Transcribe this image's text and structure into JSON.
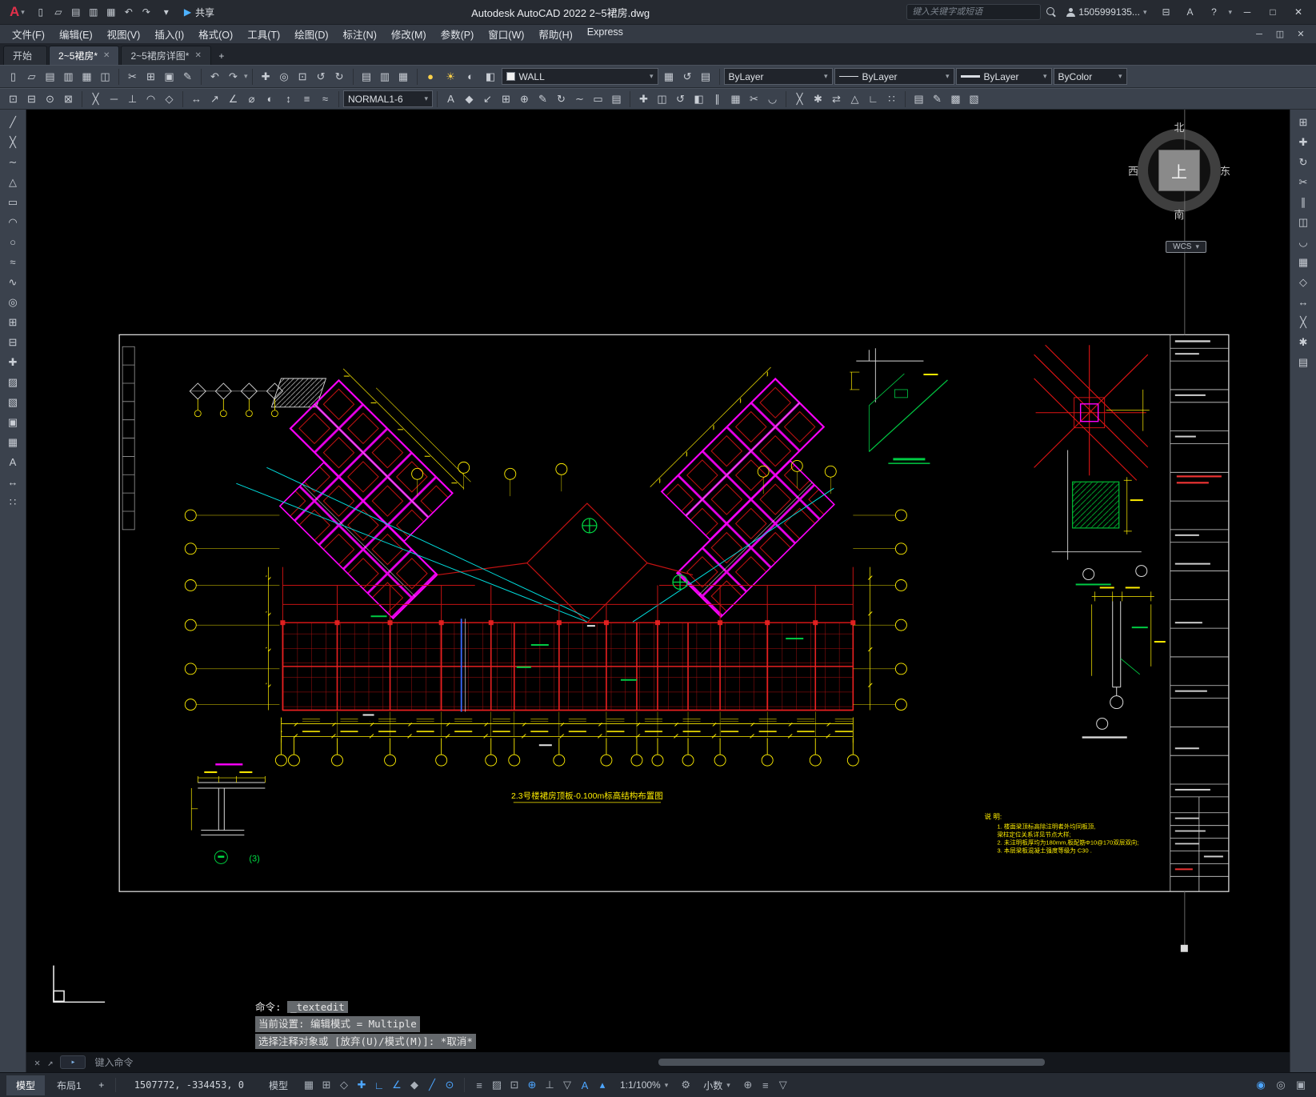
{
  "window": {
    "app_button": "A",
    "app_caret": "▾",
    "title": "Autodesk AutoCAD 2022   2~5裙房.dwg",
    "share": "共享",
    "share_icon": "▶",
    "search_placeholder": "键入关键字或短语",
    "account": "1505999135...",
    "store_icon": "⊟",
    "app_store_icon": "A",
    "help_icon": "?",
    "quick_access": [
      {
        "name": "qnew-icon",
        "glyph": "▯"
      },
      {
        "name": "open-icon",
        "glyph": "▱"
      },
      {
        "name": "save-icon",
        "glyph": "▤"
      },
      {
        "name": "saveas-icon",
        "glyph": "▥"
      },
      {
        "name": "plot-icon",
        "glyph": "▦"
      },
      {
        "name": "undo-icon",
        "glyph": "↶"
      },
      {
        "name": "redo-icon",
        "glyph": "↷"
      }
    ],
    "window_buttons": [
      {
        "name": "minimize-button",
        "glyph": "─"
      },
      {
        "name": "maximize-button",
        "glyph": "□"
      },
      {
        "name": "close-button",
        "glyph": "✕"
      }
    ]
  },
  "menubar": {
    "items": [
      "文件(F)",
      "编辑(E)",
      "视图(V)",
      "插入(I)",
      "格式(O)",
      "工具(T)",
      "绘图(D)",
      "标注(N)",
      "修改(M)",
      "参数(P)",
      "窗口(W)",
      "帮助(H)",
      "Express"
    ],
    "doc_buttons": [
      {
        "name": "doc-minimize-button",
        "glyph": "─"
      },
      {
        "name": "doc-restore-button",
        "glyph": "◫"
      },
      {
        "name": "doc-close-button",
        "glyph": "✕"
      }
    ]
  },
  "tabs": {
    "items": [
      {
        "name": "start",
        "label": "开始",
        "active": false,
        "close": ""
      },
      {
        "name": "drawing-1",
        "label": "2~5裙房*",
        "active": true,
        "close": "✕"
      },
      {
        "name": "drawing-2",
        "label": "2~5裙房详图*",
        "active": false,
        "close": "✕"
      }
    ],
    "new_tab": "+"
  },
  "toolbar1": {
    "g_file": [
      {
        "name": "new-icon",
        "glyph": "▯"
      },
      {
        "name": "open-icon",
        "glyph": "▱"
      },
      {
        "name": "save-icon",
        "glyph": "▤"
      },
      {
        "name": "saveas-icon",
        "glyph": "▥"
      },
      {
        "name": "plot-icon",
        "glyph": "▦"
      },
      {
        "name": "plot-preview-icon",
        "glyph": "◫"
      }
    ],
    "g_clip": [
      {
        "name": "cut-icon",
        "glyph": "✂"
      },
      {
        "name": "copy-icon",
        "glyph": "⊞"
      },
      {
        "name": "paste-icon",
        "glyph": "▣"
      },
      {
        "name": "match-properties-icon",
        "glyph": "✎"
      }
    ],
    "g_undo": [
      {
        "name": "undo-icon",
        "glyph": "↶"
      },
      {
        "name": "redo-icon",
        "glyph": "↷"
      }
    ],
    "g_view": [
      {
        "name": "pan-icon",
        "glyph": "✚"
      },
      {
        "name": "zoom-realtime-icon",
        "glyph": "◎"
      },
      {
        "name": "zoom-window-icon",
        "glyph": "⊡"
      },
      {
        "name": "zoom-previous-icon",
        "glyph": "↺"
      },
      {
        "name": "orbit-icon",
        "glyph": "↻"
      }
    ],
    "g_palette": [
      {
        "name": "properties-palette-icon",
        "glyph": "▤"
      },
      {
        "name": "designcenter-icon",
        "glyph": "▥"
      },
      {
        "name": "tool-palettes-icon",
        "glyph": "▦"
      }
    ],
    "layer_tools": {
      "bulb": "●",
      "sun": "☀",
      "isolate": "◐",
      "lock": "◧"
    },
    "layer_combo": {
      "value": "WALL"
    },
    "layer_state": [
      {
        "name": "layer-properties-icon",
        "glyph": "▦"
      },
      {
        "name": "layer-previous-icon",
        "glyph": "↺"
      },
      {
        "name": "layer-states-icon",
        "glyph": "▤"
      }
    ],
    "color_combo": {
      "value": "ByLayer"
    },
    "linetype_combo": {
      "value": "ByLayer"
    },
    "lineweight_combo": {
      "value": "ByLayer"
    },
    "plotstyle_combo": {
      "value": "ByColor"
    }
  },
  "toolbar2": {
    "g1": [
      {
        "name": "snap-endpoint-icon",
        "glyph": "⊡"
      },
      {
        "name": "snap-midpoint-icon",
        "glyph": "⊟"
      },
      {
        "name": "snap-center-icon",
        "glyph": "⊙"
      },
      {
        "name": "snap-node-icon",
        "glyph": "⊠"
      }
    ],
    "g2": [
      {
        "name": "snap-intersection-icon",
        "glyph": "╳"
      },
      {
        "name": "snap-extension-icon",
        "glyph": "─"
      },
      {
        "name": "snap-perpendicular-icon",
        "glyph": "⊥"
      },
      {
        "name": "snap-tangent-icon",
        "glyph": "◠"
      },
      {
        "name": "snap-nearest-icon",
        "glyph": "◇"
      }
    ],
    "g3": [
      {
        "name": "linear-dimension-icon",
        "glyph": "↔"
      },
      {
        "name": "aligned-dimension-icon",
        "glyph": "↗"
      },
      {
        "name": "angular-dimension-icon",
        "glyph": "∠"
      },
      {
        "name": "diameter-dimension-icon",
        "glyph": "⌀"
      },
      {
        "name": "radius-dimension-icon",
        "glyph": "◐"
      },
      {
        "name": "ordinate-dimension-icon",
        "glyph": "↕"
      },
      {
        "name": "baseline-dimension-icon",
        "glyph": "≡"
      },
      {
        "name": "continue-dimension-icon",
        "glyph": "≈"
      }
    ],
    "style_combo": {
      "value": "NORMAL1-6"
    },
    "g4": [
      {
        "name": "text-style-icon",
        "glyph": "A"
      },
      {
        "name": "dimension-style-icon",
        "glyph": "◆"
      },
      {
        "name": "multileader-icon",
        "glyph": "↙"
      },
      {
        "name": "tolerance-icon",
        "glyph": "⊞"
      },
      {
        "name": "center-mark-icon",
        "glyph": "⊕"
      },
      {
        "name": "dimension-edit-icon",
        "glyph": "✎"
      },
      {
        "name": "dimension-update-icon",
        "glyph": "↻"
      },
      {
        "name": "measure-icon",
        "glyph": "∼"
      },
      {
        "name": "area-icon",
        "glyph": "▭"
      },
      {
        "name": "list-icon",
        "glyph": "▤"
      }
    ],
    "g5": [
      {
        "name": "move-icon",
        "glyph": "✚"
      },
      {
        "name": "copy-object-icon",
        "glyph": "◫"
      },
      {
        "name": "rotate-icon",
        "glyph": "↺"
      },
      {
        "name": "mirror-icon",
        "glyph": "◧"
      },
      {
        "name": "offset-icon",
        "glyph": "∥"
      },
      {
        "name": "array-icon",
        "glyph": "▦"
      },
      {
        "name": "trim-icon",
        "glyph": "✂"
      },
      {
        "name": "fillet-icon",
        "glyph": "◡"
      }
    ],
    "g6": [
      {
        "name": "erase-icon",
        "glyph": "╳"
      },
      {
        "name": "explode-icon",
        "glyph": "✱"
      },
      {
        "name": "stretch-icon",
        "glyph": "⇄"
      },
      {
        "name": "scale-icon",
        "glyph": "△"
      },
      {
        "name": "break-icon",
        "glyph": "∟"
      },
      {
        "name": "join-icon",
        "glyph": "∷"
      }
    ],
    "g7": [
      {
        "name": "quick-properties-icon",
        "glyph": "▤"
      },
      {
        "name": "match-icon",
        "glyph": "✎"
      },
      {
        "name": "group-icon",
        "glyph": "▩"
      },
      {
        "name": "ungroup-icon",
        "glyph": "▧"
      }
    ]
  },
  "left_toolbar": {
    "icons": [
      {
        "name": "line-icon",
        "glyph": "╱"
      },
      {
        "name": "construction-line-icon",
        "glyph": "╳"
      },
      {
        "name": "polyline-icon",
        "glyph": "∼"
      },
      {
        "name": "polygon-icon",
        "glyph": "△"
      },
      {
        "name": "rectangle-icon",
        "glyph": "▭"
      },
      {
        "name": "arc-icon",
        "glyph": "◠"
      },
      {
        "name": "circle-icon",
        "glyph": "○"
      },
      {
        "name": "revision-cloud-icon",
        "glyph": "≈"
      },
      {
        "name": "spline-icon",
        "glyph": "∿"
      },
      {
        "name": "ellipse-icon",
        "glyph": "◎"
      },
      {
        "name": "insert-block-icon",
        "glyph": "⊞"
      },
      {
        "name": "make-block-icon",
        "glyph": "⊟"
      },
      {
        "name": "point-icon",
        "glyph": "✚"
      },
      {
        "name": "hatch-icon",
        "glyph": "▨"
      },
      {
        "name": "gradient-icon",
        "glyph": "▧"
      },
      {
        "name": "region-icon",
        "glyph": "▣"
      },
      {
        "name": "table-icon",
        "glyph": "▦"
      },
      {
        "name": "multiline-text-icon",
        "glyph": "A"
      },
      {
        "name": "dimension-icon",
        "glyph": "↔"
      },
      {
        "name": "color-dots-icon",
        "glyph": "∷"
      }
    ]
  },
  "right_toolbar": {
    "icons": [
      {
        "name": "measure-icon",
        "glyph": "⊞"
      },
      {
        "name": "move-icon",
        "glyph": "✚"
      },
      {
        "name": "rotate-icon",
        "glyph": "↻"
      },
      {
        "name": "trim-icon",
        "glyph": "✂"
      },
      {
        "name": "offset-icon",
        "glyph": "∥"
      },
      {
        "name": "mirror-icon",
        "glyph": "◫"
      },
      {
        "name": "fillet-icon",
        "glyph": "◡"
      },
      {
        "name": "array-icon",
        "glyph": "▦"
      },
      {
        "name": "scale-icon",
        "glyph": "◇"
      },
      {
        "name": "stretch-icon",
        "glyph": "↔"
      },
      {
        "name": "erase-icon",
        "glyph": "╳"
      },
      {
        "name": "explode-icon",
        "glyph": "✱"
      },
      {
        "name": "properties-icon",
        "glyph": "▤"
      }
    ]
  },
  "viewcube": {
    "north": "北",
    "south": "南",
    "west": "西",
    "east": "东",
    "top": "上",
    "wcs": "WCS",
    "wcs_caret": "▾"
  },
  "drawing": {
    "plan_title": "2.3号楼裙房顶板-0.100m标高结构布置图",
    "detail_ref": "(3)",
    "notes_title": "说 明:",
    "notes": [
      "1. 楼面梁顶标高除注明者外均同板顶,",
      "   梁柱定位关系详见节点大样;",
      "2. 未注明板厚均为180mm,板配筋Φ10@170双层双向;",
      "3. 本层梁板混凝土强度等级为 C30 ."
    ],
    "colors": {
      "grid": "#d41616",
      "walls": "#ff00ff",
      "dimensions": "#ffee00",
      "annotations": "#00cc44",
      "reference": "#00dddd"
    }
  },
  "command": {
    "history_prefix": "命令:",
    "history_value": "_textedit",
    "history_line2": "当前设置: 编辑模式 = Multiple",
    "history_line3": "选择注释对象或 [放弃(U)/模式(M)]: *取消*",
    "prompt": "键入命令",
    "close_icon": "✕",
    "popout_icon": "↗",
    "prompt_icon": "▸"
  },
  "statusbar": {
    "model_tab": "模型",
    "layout_tab": "布局1",
    "new_layout": "+",
    "coords": "1507772, -334453, 0",
    "space_toggle": "模型",
    "icons_a": [
      {
        "name": "grid-display",
        "glyph": "▦",
        "active": false
      },
      {
        "name": "snap-mode",
        "glyph": "⊞",
        "active": false
      },
      {
        "name": "infer-constraints",
        "glyph": "◇",
        "active": false
      },
      {
        "name": "dynamic-input",
        "glyph": "✚",
        "active": true
      },
      {
        "name": "ortho-mode",
        "glyph": "∟",
        "active": true
      },
      {
        "name": "polar-tracking",
        "glyph": "∠",
        "active": true
      },
      {
        "name": "isometric-drafting",
        "glyph": "◆",
        "active": false
      },
      {
        "name": "object-snap-tracking",
        "glyph": "╱",
        "active": true
      },
      {
        "name": "object-snap",
        "glyph": "⊙",
        "active": true
      }
    ],
    "icons_b": [
      {
        "name": "lineweight-display",
        "glyph": "≡",
        "active": false
      },
      {
        "name": "transparency",
        "glyph": "▨",
        "active": false
      },
      {
        "name": "selection-cycling",
        "glyph": "⊡",
        "active": false
      },
      {
        "name": "3d-object-snap",
        "glyph": "⊕",
        "active": true
      },
      {
        "name": "dynamic-ucs",
        "glyph": "⊥",
        "active": false
      },
      {
        "name": "selection-filtering",
        "glyph": "▽",
        "active": false
      },
      {
        "name": "annotation-visibility",
        "glyph": "A",
        "active": true
      },
      {
        "name": "autoscale",
        "glyph": "▴",
        "active": true
      }
    ],
    "scale": "1:1/100%",
    "scale_caret": "▾",
    "gear_icon": "⚙",
    "precision": "小数",
    "precision_caret": "▾",
    "icons_c": [
      {
        "name": "annotation-monitor",
        "glyph": "⊕",
        "active": false
      },
      {
        "name": "customization-menu",
        "glyph": "≡",
        "active": false
      },
      {
        "name": "filter",
        "glyph": "▽",
        "active": false
      }
    ],
    "icons_right": [
      {
        "name": "graphics-performance",
        "glyph": "◉",
        "active": true
      },
      {
        "name": "isolate-objects",
        "glyph": "◎",
        "active": false
      },
      {
        "name": "clean-screen",
        "glyph": "▣",
        "active": false
      }
    ]
  }
}
